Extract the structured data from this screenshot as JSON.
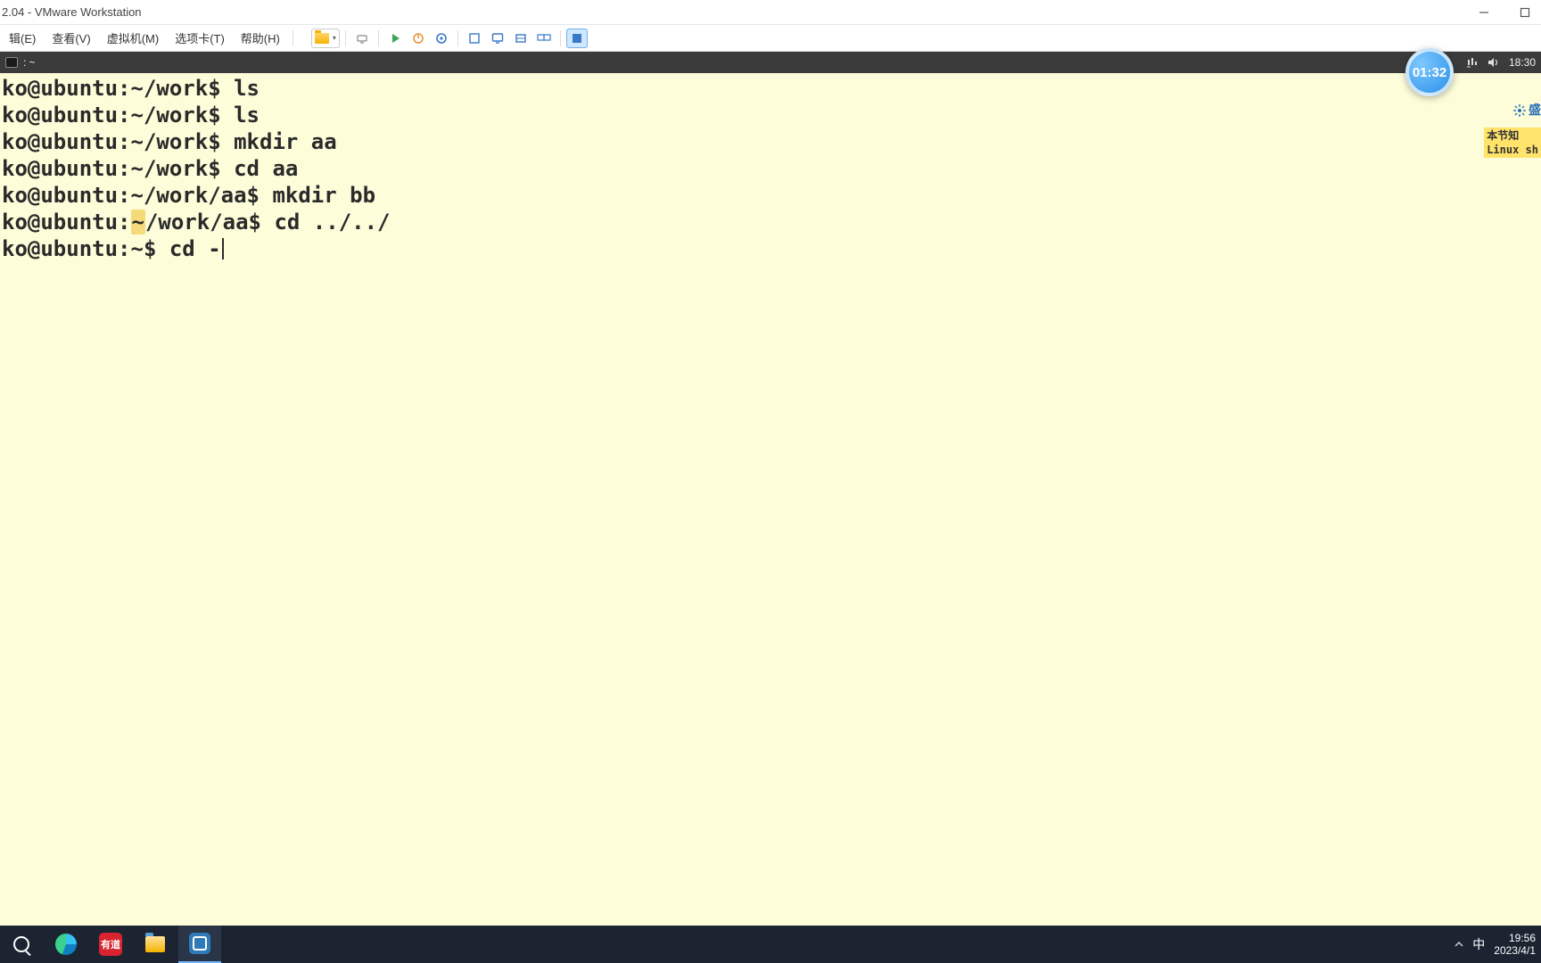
{
  "window": {
    "title": "2.04 - VMware Workstation"
  },
  "menu": {
    "edit": "辑(E)",
    "view": "查看(V)",
    "vm": "虚拟机(M)",
    "tabs": "选项卡(T)",
    "help": "帮助(H)"
  },
  "toolbar": {
    "library_dd": "▾"
  },
  "ubuntu_panel": {
    "left_title": ": ~",
    "time": "18:30"
  },
  "overlay": {
    "clock": "01:32",
    "watermark": "盛",
    "note_line1": "本节知",
    "note_line2": "Linux sh"
  },
  "terminal": {
    "lines": [
      {
        "prompt": "ko@ubuntu:~/work$ ",
        "cmd": "ls"
      },
      {
        "prompt": "ko@ubuntu:~/work$ ",
        "cmd": "ls"
      },
      {
        "prompt": "ko@ubuntu:~/work$ ",
        "cmd": "mkdir aa"
      },
      {
        "prompt": "ko@ubuntu:~/work$ ",
        "cmd": "cd aa"
      },
      {
        "prompt": "ko@ubuntu:~/work/aa$ ",
        "cmd": "mkdir bb"
      },
      {
        "prompt_pre": "ko@ubuntu:",
        "prompt_hi": "~",
        "prompt_post": "/work/aa$ ",
        "cmd": "cd ../../"
      },
      {
        "prompt": "ko@ubuntu:~$ ",
        "cmd": "cd -",
        "cursor": true
      }
    ]
  },
  "taskbar": {
    "youdao": "有道",
    "ime": "中",
    "time": "19:56",
    "date": "2023/4/1"
  }
}
